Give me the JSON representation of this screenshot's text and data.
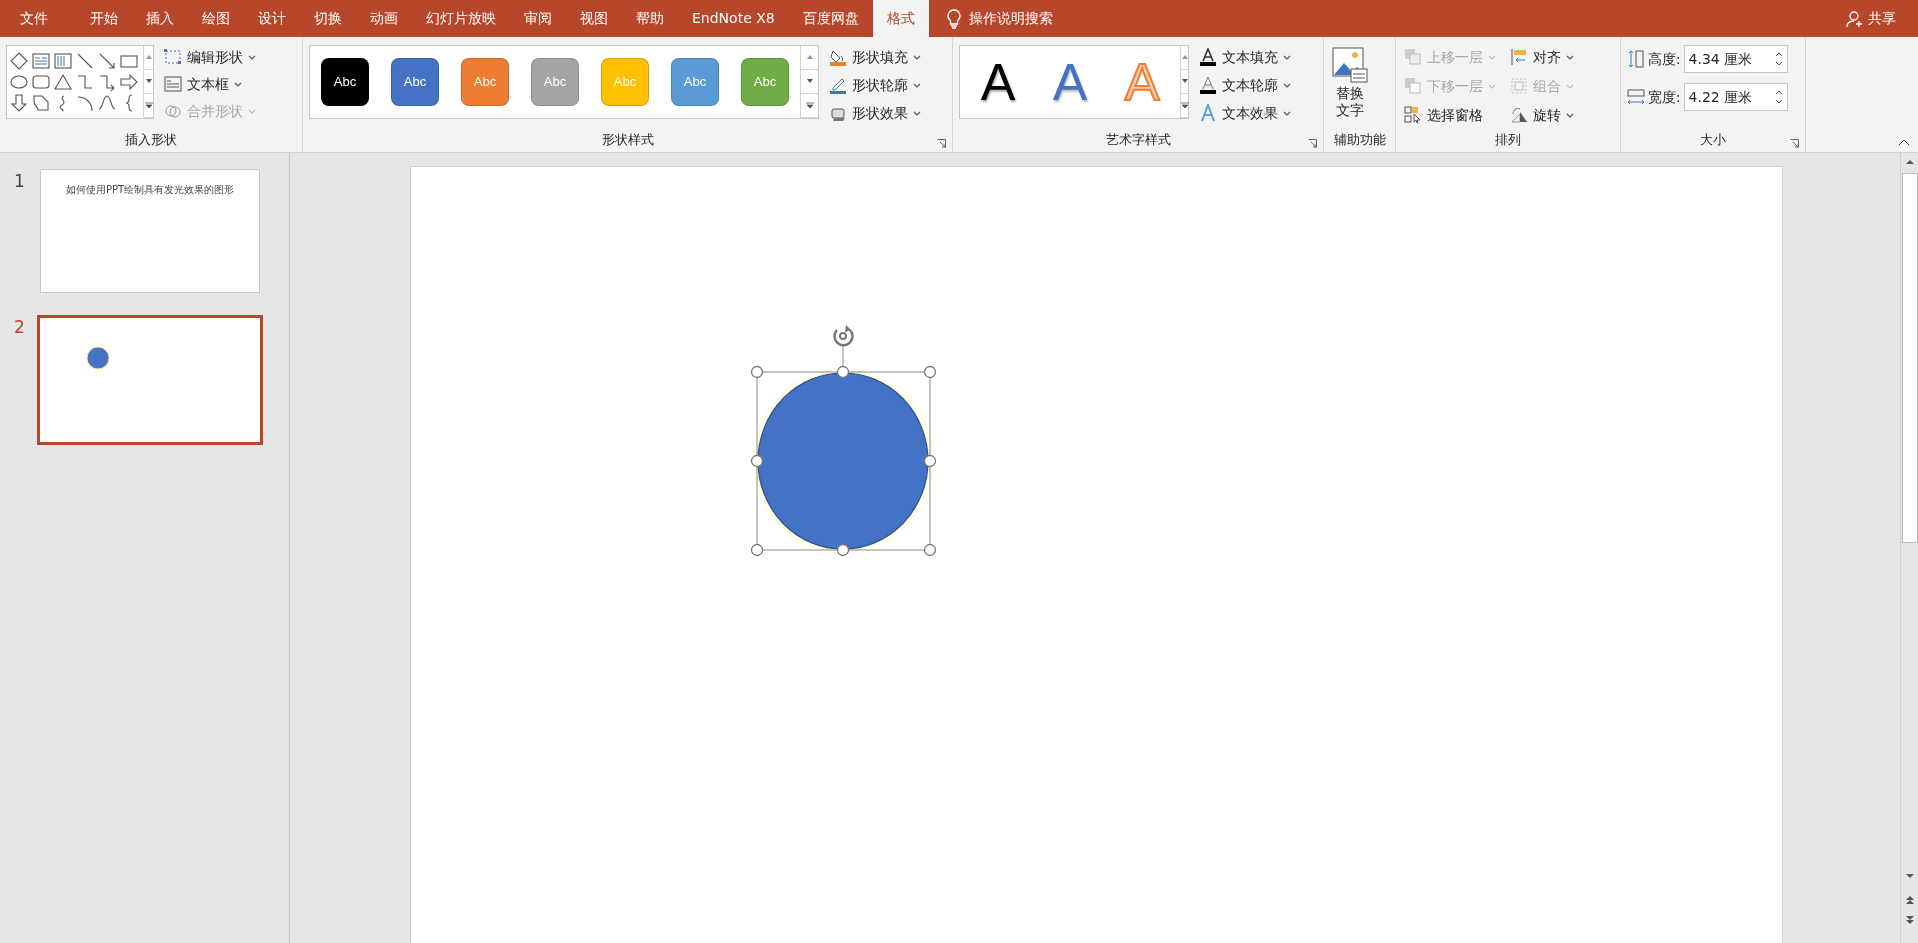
{
  "tabs": [
    {
      "label": "文件",
      "selected": false
    },
    {
      "label": "开始",
      "selected": false
    },
    {
      "label": "插入",
      "selected": false
    },
    {
      "label": "绘图",
      "selected": false
    },
    {
      "label": "设计",
      "selected": false
    },
    {
      "label": "切换",
      "selected": false
    },
    {
      "label": "动画",
      "selected": false
    },
    {
      "label": "幻灯片放映",
      "selected": false
    },
    {
      "label": "审阅",
      "selected": false
    },
    {
      "label": "视图",
      "selected": false
    },
    {
      "label": "帮助",
      "selected": false
    },
    {
      "label": "EndNote X8",
      "selected": false
    },
    {
      "label": "百度网盘",
      "selected": false
    },
    {
      "label": "格式",
      "selected": true
    }
  ],
  "search": {
    "label": "操作说明搜索"
  },
  "share": {
    "label": "共享"
  },
  "insert_shapes": {
    "title": "插入形状",
    "commands": [
      {
        "label": "编辑形状",
        "disabled": false
      },
      {
        "label": "文本框",
        "disabled": false
      },
      {
        "label": "合并形状",
        "disabled": true
      }
    ]
  },
  "shape_styles": {
    "title": "形状样式",
    "swatches": [
      {
        "label": "Abc",
        "color": "#000000"
      },
      {
        "label": "Abc",
        "color": "#4472c4"
      },
      {
        "label": "Abc",
        "color": "#ed7d31"
      },
      {
        "label": "Abc",
        "color": "#a5a5a5"
      },
      {
        "label": "Abc",
        "color": "#ffc000"
      },
      {
        "label": "Abc",
        "color": "#5b9bd5"
      },
      {
        "label": "Abc",
        "color": "#70ad47"
      }
    ],
    "commands": [
      {
        "label": "形状填充",
        "kind": "fill"
      },
      {
        "label": "形状轮廓",
        "kind": "outline"
      },
      {
        "label": "形状效果",
        "kind": "effect"
      }
    ]
  },
  "wordart": {
    "title": "艺术字样式",
    "samples": [
      {
        "label": "A",
        "kind": "solid"
      },
      {
        "label": "A",
        "kind": "blue"
      },
      {
        "label": "A",
        "kind": "outline"
      }
    ],
    "commands": [
      {
        "label": "文本填充",
        "kind": "fill"
      },
      {
        "label": "文本轮廓",
        "kind": "outline"
      },
      {
        "label": "文本效果",
        "kind": "effect"
      }
    ]
  },
  "accessibility": {
    "title": "辅助功能",
    "button": [
      "替换",
      "文字"
    ]
  },
  "arrange": {
    "title": "排列",
    "commands": [
      {
        "label": "上移一层",
        "disabled": true,
        "kind": "forward"
      },
      {
        "label": "对齐",
        "disabled": false,
        "kind": "align"
      },
      {
        "label": "下移一层",
        "disabled": true,
        "kind": "backward"
      },
      {
        "label": "组合",
        "disabled": true,
        "kind": "group"
      },
      {
        "label": "选择窗格",
        "disabled": false,
        "kind": "pane"
      },
      {
        "label": "旋转",
        "disabled": false,
        "kind": "rotate"
      }
    ]
  },
  "size": {
    "title": "大小",
    "fields": [
      {
        "label": "高度:",
        "value": "4.34 厘米",
        "kind": "height"
      },
      {
        "label": "宽度:",
        "value": "4.22 厘米",
        "kind": "width"
      }
    ]
  },
  "slides": [
    {
      "number": "1",
      "selected": false,
      "kind": "title",
      "title": "如何使用PPT绘制具有发光效果的图形"
    },
    {
      "number": "2",
      "selected": true,
      "kind": "circle"
    }
  ],
  "canvas": {
    "shape": {
      "kind": "circle",
      "selected": true
    }
  }
}
